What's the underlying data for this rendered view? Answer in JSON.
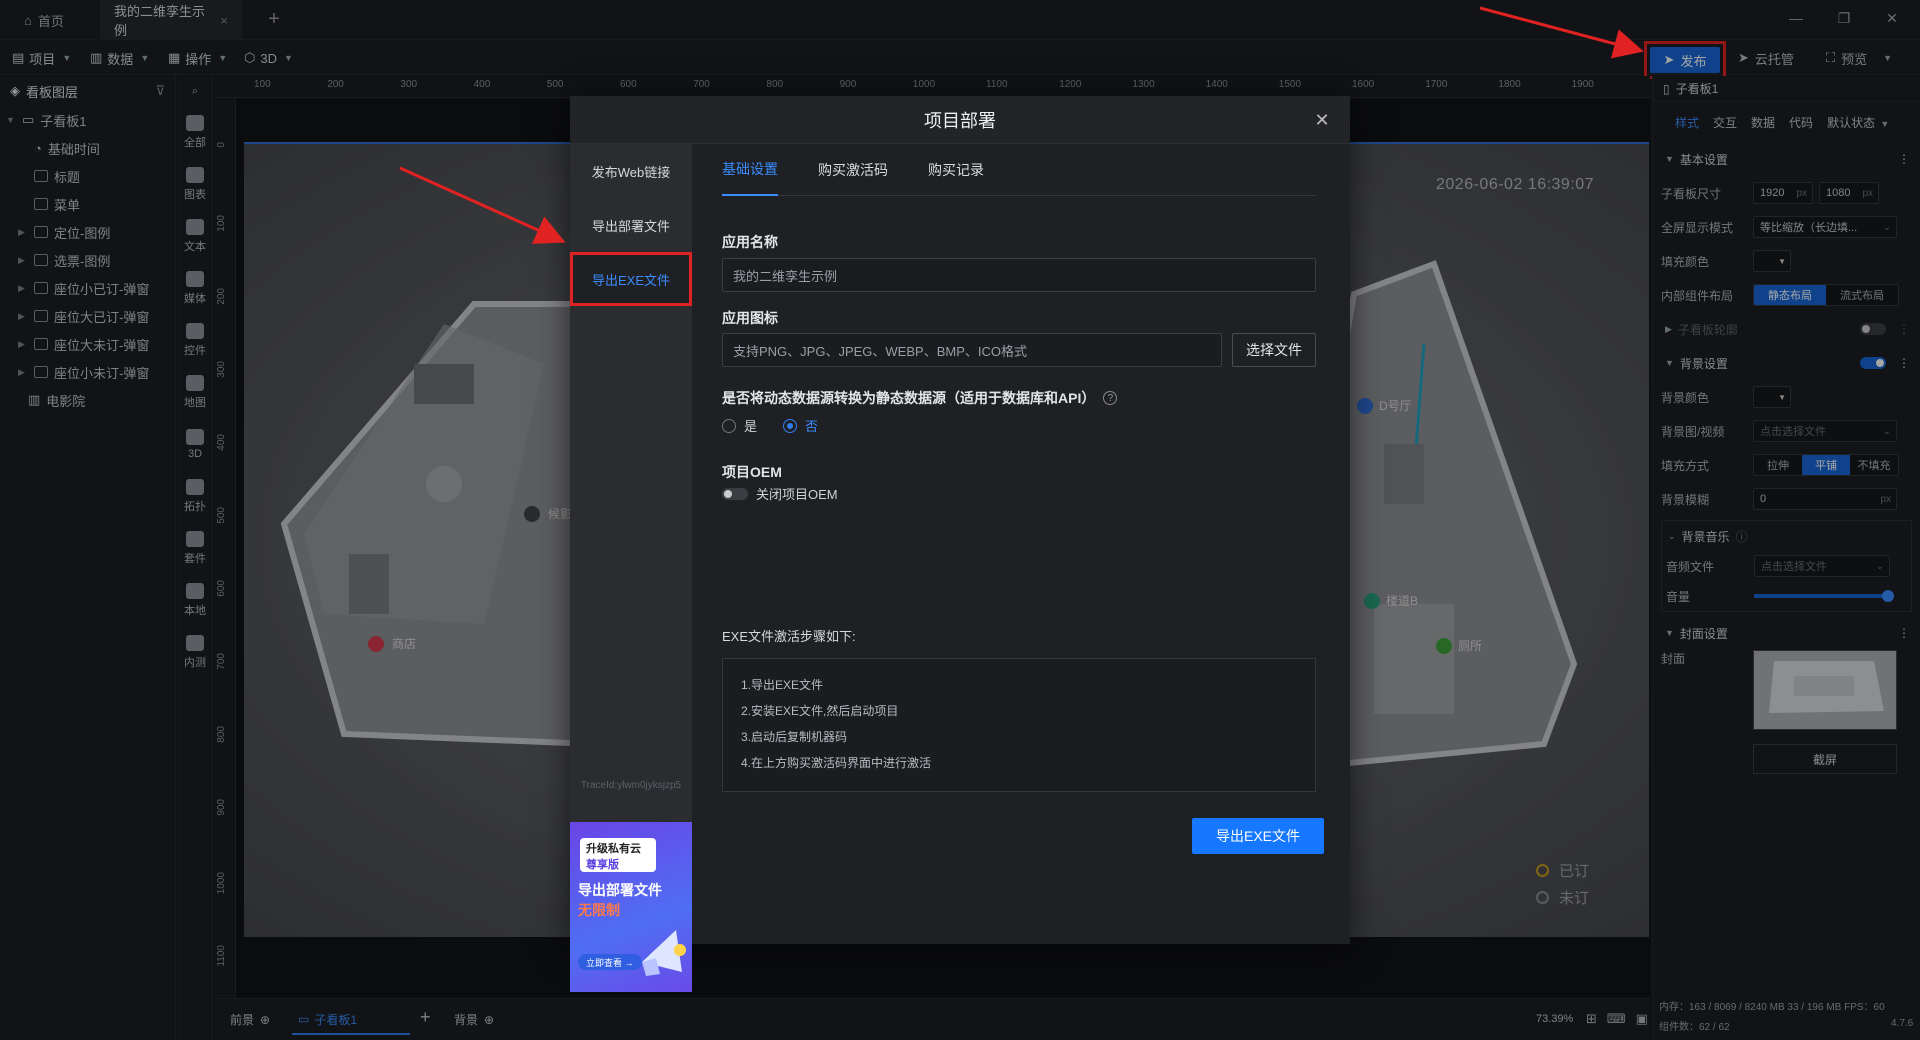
{
  "tabs": {
    "home": "首页",
    "project": "我的二维孪生示例"
  },
  "toolbar": {
    "menus": [
      "项目",
      "数据",
      "操作",
      "3D"
    ],
    "publish": "发布",
    "cloud": "云托管",
    "preview": "预览"
  },
  "layers": {
    "title": "看板图层",
    "root": "子看板1",
    "items": [
      "基础时间",
      "标题",
      "菜单",
      "定位-图例",
      "选票-图例",
      "座位小已订-弹窗",
      "座位大已订-弹窗",
      "座位大未订-弹窗",
      "座位小未订-弹窗",
      "电影院"
    ]
  },
  "tools": [
    "全部",
    "图表",
    "文本",
    "媒体",
    "控件",
    "地图",
    "3D",
    "拓扑",
    "套件",
    "本地",
    "内测"
  ],
  "ruler": {
    "h": [
      "100",
      "200",
      "300",
      "400",
      "500",
      "600",
      "700",
      "800",
      "900",
      "1000",
      "1100",
      "1200",
      "1300",
      "1400",
      "1500",
      "1600",
      "1700",
      "1800",
      "1900"
    ],
    "v": [
      "0",
      "100",
      "200",
      "300",
      "400",
      "500",
      "600",
      "700",
      "800",
      "900",
      "1000",
      "1100"
    ]
  },
  "canvas": {
    "timestamp": "2026-06-02 16:39:07",
    "labels": {
      "shop": "商店",
      "rest": "候影",
      "hallD": "D号厅",
      "stairB": "楼道B",
      "wc": "厕所"
    },
    "legend": [
      {
        "label": "已订",
        "color": "#c89a1e"
      },
      {
        "label": "未订",
        "color": "#8a8d92"
      }
    ]
  },
  "bottom": {
    "front": "前景",
    "board": "子看板1",
    "back": "背景",
    "zoom": "73.39%"
  },
  "right": {
    "title": "子看板1",
    "tabs": [
      "样式",
      "交互",
      "数据",
      "代码"
    ],
    "state": "默认状态",
    "basic": "基本设置",
    "size_label": "子看板尺寸",
    "width": "1920",
    "height": "1080",
    "unit": "px",
    "fullscreen_label": "全屏显示模式",
    "fullscreen_value": "等比缩放（长边填...",
    "fill_label": "填充颜色",
    "layout_label": "内部组件布局",
    "layout_opts": [
      "静态布局",
      "流式布局"
    ],
    "outline": "子看板轮廓",
    "bg": "背景设置",
    "bgcolor_label": "背景颜色",
    "bgimg_label": "背景图/视频",
    "pick_file": "点击选择文件",
    "fillmode_label": "填充方式",
    "fillmode_opts": [
      "拉伸",
      "平铺",
      "不填充"
    ],
    "blur_label": "背景模糊",
    "blur_value": "0",
    "music": "背景音乐",
    "audio_label": "音频文件",
    "volume_label": "音量",
    "volume": 1.0,
    "cover": "封面设置",
    "cover_label": "封面",
    "screenshot": "截屏",
    "status1": "内存：163 / 8069 / 8240 MB  33 / 196 MB   FPS：60",
    "status2": "组件数：62 / 62",
    "version": "4.7.6"
  },
  "modal": {
    "title": "项目部署",
    "nav": [
      "发布Web链接",
      "导出部署文件",
      "导出EXE文件"
    ],
    "trace": "TraceId:ylwm0jyksjzp5",
    "promo": {
      "badge1": "升级私有云",
      "badge2": "尊享版",
      "line1": "导出部署文件",
      "line2": "无限制",
      "cta": "立即查看 →"
    },
    "tabs": [
      "基础设置",
      "购买激活码",
      "购买记录"
    ],
    "app_name_label": "应用名称",
    "app_name_value": "我的二维孪生示例",
    "icon_label": "应用图标",
    "icon_placeholder": "支持PNG、JPG、JPEG、WEBP、BMP、ICO格式",
    "choose_file": "选择文件",
    "convert_label": "是否将动态数据源转换为静态数据源（适用于数据库和API）",
    "yes": "是",
    "no": "否",
    "oem_label": "项目OEM",
    "oem_toggle": "关闭项目OEM",
    "steps_title": "EXE文件激活步骤如下:",
    "steps": [
      "1.导出EXE文件",
      "2.安装EXE文件,然后启动项目",
      "3.启动后复制机器码",
      "4.在上方购买激活码界面中进行激活"
    ],
    "export_btn": "导出EXE文件"
  }
}
